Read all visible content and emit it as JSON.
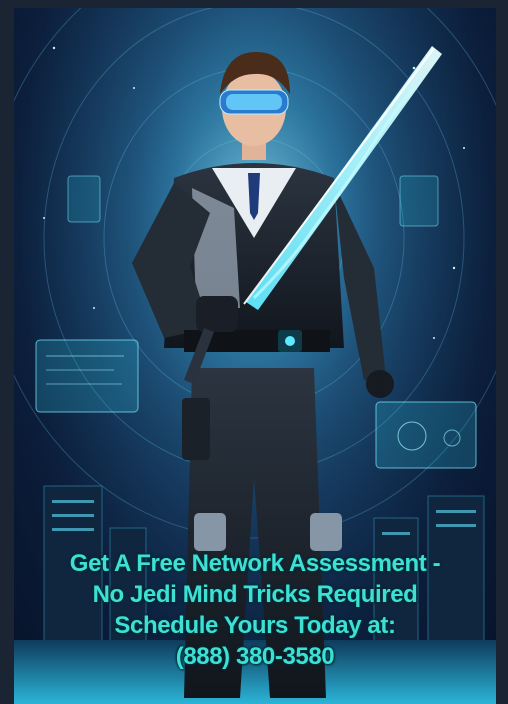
{
  "poster": {
    "lines": [
      "Get A Free Network Assessment -",
      "No Jedi Mind Tricks Required",
      "Schedule Yours Today at:",
      "(888) 380-3580"
    ]
  },
  "colors": {
    "text": "#3ee0d4",
    "background": "#0b1d3a",
    "glow": "#7ff0ff",
    "frame": "#1b2433"
  },
  "image": {
    "subject": "hero-in-tactical-suit-with-glowing-sword-icon"
  }
}
